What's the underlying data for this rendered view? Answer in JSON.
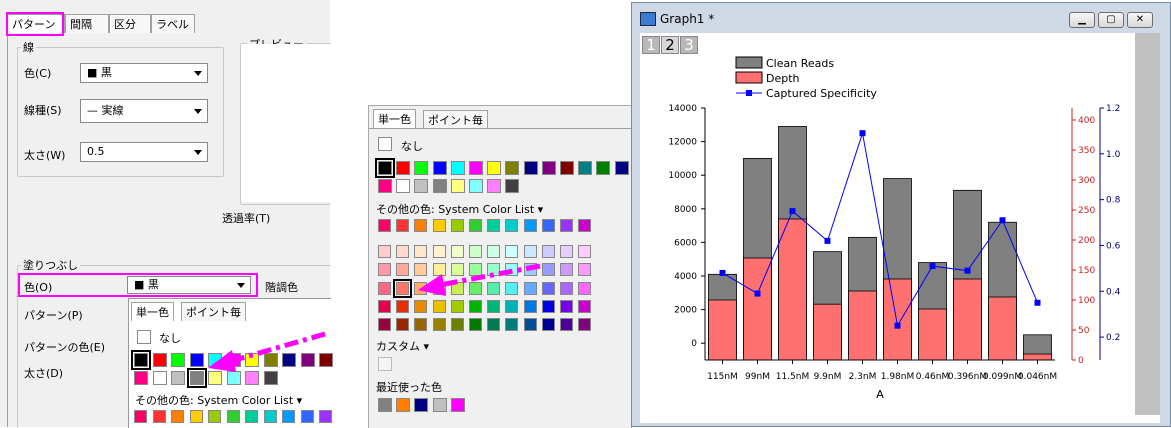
{
  "left_dialog": {
    "tabs": [
      "パターン",
      "間隔",
      "区分",
      "ラベル"
    ],
    "line_group": "線",
    "color_label": "色(C)",
    "color_value": "■ 黒",
    "linetype_label": "線種(S)",
    "linetype_value": "— 実線",
    "width_label": "太さ(W)",
    "width_value": "0.5",
    "preview_label": "プレビュー",
    "transparency_label": "透過率(T)",
    "fill_group": "塗りつぶし",
    "fill_color_label": "色(O)",
    "fill_color_value": "■ 黒",
    "gradient_label": "階調色",
    "pattern_label": "パターン(P)",
    "pattern_color_label": "パターンの色(E)",
    "fill_width_label": "太さ(D)"
  },
  "small_popup": {
    "tabs": [
      "単一色",
      "ポイント毎"
    ],
    "none_label": "なし",
    "other_colors_label": "その他の色: System Color List",
    "row1": [
      "#000000",
      "#ff0000",
      "#00ff00",
      "#0000ff",
      "#00ffff",
      "#ff00ff",
      "#ffff00",
      "#808000",
      "#000080",
      "#800080",
      "#800000"
    ],
    "row2": [
      "#ff0080",
      "#ffffff",
      "#c0c0c0",
      "#808080",
      "#ffff80",
      "#80ffff",
      "#ff80ff",
      "#404040"
    ],
    "list_row": [
      "#ff0066",
      "#ff3333",
      "#ff8000",
      "#ffcc00",
      "#99cc00",
      "#33cc33",
      "#00cc99",
      "#00cccc",
      "#0099ff",
      "#3366ff",
      "#9933ff"
    ]
  },
  "big_popup": {
    "tabs": [
      "単一色",
      "ポイント毎"
    ],
    "none_label": "なし",
    "other_colors_label": "その他の色: System Color List",
    "custom_label": "カスタム",
    "recent_label": "最近使った色",
    "row1": [
      "#000000",
      "#ff0000",
      "#00ff00",
      "#0000ff",
      "#00ffff",
      "#ff00ff",
      "#ffff00",
      "#808000",
      "#000080",
      "#800080",
      "#800000",
      "#008080",
      "#008000",
      "#000080"
    ],
    "row2": [
      "#ff0080",
      "#ffffff",
      "#c0c0c0",
      "#808080",
      "#ffff80",
      "#80ffff",
      "#ff80ff",
      "#404040"
    ],
    "list_row": [
      "#ff0066",
      "#ff3333",
      "#ff8000",
      "#ffcc00",
      "#99cc00",
      "#33cc33",
      "#00cc99",
      "#00cccc",
      "#0099ff",
      "#3366ff",
      "#9933ff",
      "#cc00cc"
    ],
    "grid": [
      [
        "#ffcccc",
        "#ffd9cc",
        "#ffe6cc",
        "#fff2cc",
        "#f2ffcc",
        "#ccffcc",
        "#ccffe6",
        "#ccffff",
        "#cce6ff",
        "#ccccff",
        "#e6ccff",
        "#ffccff"
      ],
      [
        "#ff99aa",
        "#ffaa99",
        "#ffcc99",
        "#ffee99",
        "#ddff99",
        "#99ff99",
        "#99ffcc",
        "#99ffff",
        "#99ccff",
        "#9999ff",
        "#cc99ff",
        "#ff99ff"
      ],
      [
        "#ff6688",
        "#ff7766",
        "#ffaa66",
        "#ffdd66",
        "#ccee55",
        "#66ee66",
        "#55eeaa",
        "#55eeee",
        "#66aaff",
        "#6666ff",
        "#aa66ff",
        "#ff66ff"
      ],
      [
        "#e6004c",
        "#e62e00",
        "#e68a00",
        "#e6c200",
        "#a3cc00",
        "#00b300",
        "#00b377",
        "#00b3b3",
        "#0077e6",
        "#0000e6",
        "#7700e6",
        "#cc00cc"
      ],
      [
        "#99003d",
        "#992600",
        "#996600",
        "#998000",
        "#6b8000",
        "#007a00",
        "#007a52",
        "#007a7a",
        "#004d99",
        "#000099",
        "#4d0099",
        "#800080"
      ]
    ],
    "recent": [
      "#808080",
      "#ff8000",
      "#000080",
      "#c0c0c0",
      "#ff00ff"
    ]
  },
  "graph_window": {
    "title": "Graph1 *",
    "layer_tabs": [
      "1",
      "2",
      "3"
    ]
  },
  "chart_data": {
    "type": "bar",
    "categories": [
      "115nM",
      "99nM",
      "11.5nM",
      "9.9nM",
      "2.3nM",
      "1.98nM",
      "0.46nM",
      "0.396nM",
      "0.099nM",
      "0.046nM"
    ],
    "xlabel": "A",
    "series": [
      {
        "name": "Clean Reads",
        "type": "bar",
        "color": "#808080",
        "values": [
          4100,
          11000,
          12900,
          5450,
          6300,
          9800,
          4800,
          9100,
          7200,
          500
        ]
      },
      {
        "name": "Depth",
        "type": "bar",
        "color": "#ff7070",
        "values": [
          100,
          170,
          235,
          93,
          115,
          135,
          85,
          135,
          105,
          10
        ]
      },
      {
        "name": "Captured Specificity",
        "type": "line",
        "color": "#0000ff",
        "values": [
          0.48,
          0.39,
          0.75,
          0.62,
          1.09,
          0.25,
          0.51,
          0.49,
          0.71,
          0.35
        ]
      }
    ],
    "y_left": {
      "ylim": [
        -1000,
        14000
      ],
      "ticks": [
        0,
        2000,
        4000,
        6000,
        8000,
        10000,
        12000,
        14000
      ]
    },
    "y_right1": {
      "ylim": [
        0,
        420
      ],
      "ticks": [
        0,
        50,
        100,
        150,
        200,
        250,
        300,
        350,
        400
      ],
      "color": "#cc2222"
    },
    "y_right2": {
      "ylim": [
        0.1,
        1.2
      ],
      "ticks": [
        0.2,
        0.4,
        0.6,
        0.8,
        1.0,
        1.2
      ],
      "color": "#000080"
    },
    "legend_position": "top-left"
  }
}
